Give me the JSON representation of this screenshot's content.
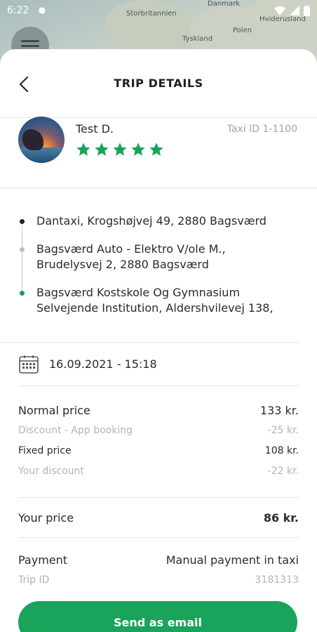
{
  "status_bar": {
    "time": "6:22"
  },
  "map": {
    "labels": [
      "Danmark",
      "Storbritannien",
      "Polen",
      "Hviderusland",
      "Tyskland"
    ]
  },
  "header": {
    "title": "TRIP DETAILS"
  },
  "driver": {
    "name": "Test D.",
    "taxi_id": "Taxi ID 1-1100",
    "rating": 5,
    "rating_max": 5
  },
  "route": {
    "stops": [
      {
        "line1": "Dantaxi, Krogshøjvej 49, 2880 Bagsværd",
        "line2": ""
      },
      {
        "line1": "Bagsværd Auto - Elektro V/ole M.,",
        "line2": "Brudelysvej 2, 2880 Bagsværd"
      },
      {
        "line1": "Bagsværd Kostskole Og Gymnasium",
        "line2": "Selvejende Institution, Aldershvilevej 138,"
      }
    ]
  },
  "datetime": "16.09.2021 - 15:18",
  "prices": {
    "normal_label": "Normal price",
    "normal_value": "133 kr.",
    "discount_label": "Discount - App booking",
    "discount_value": "-25 kr.",
    "fixed_label": "Fixed price",
    "fixed_value": "108 kr.",
    "your_discount_label": "Your discount",
    "your_discount_value": "-22 kr."
  },
  "your_price": {
    "label": "Your price",
    "value": "86 kr."
  },
  "payment": {
    "label": "Payment",
    "value": "Manual payment in taxi",
    "trip_id_label": "Trip ID",
    "trip_id_value": "3181313"
  },
  "actions": {
    "send_email": "Send as email"
  },
  "colors": {
    "accent": "#1aa35b",
    "muted_text": "#b4b4b4"
  }
}
